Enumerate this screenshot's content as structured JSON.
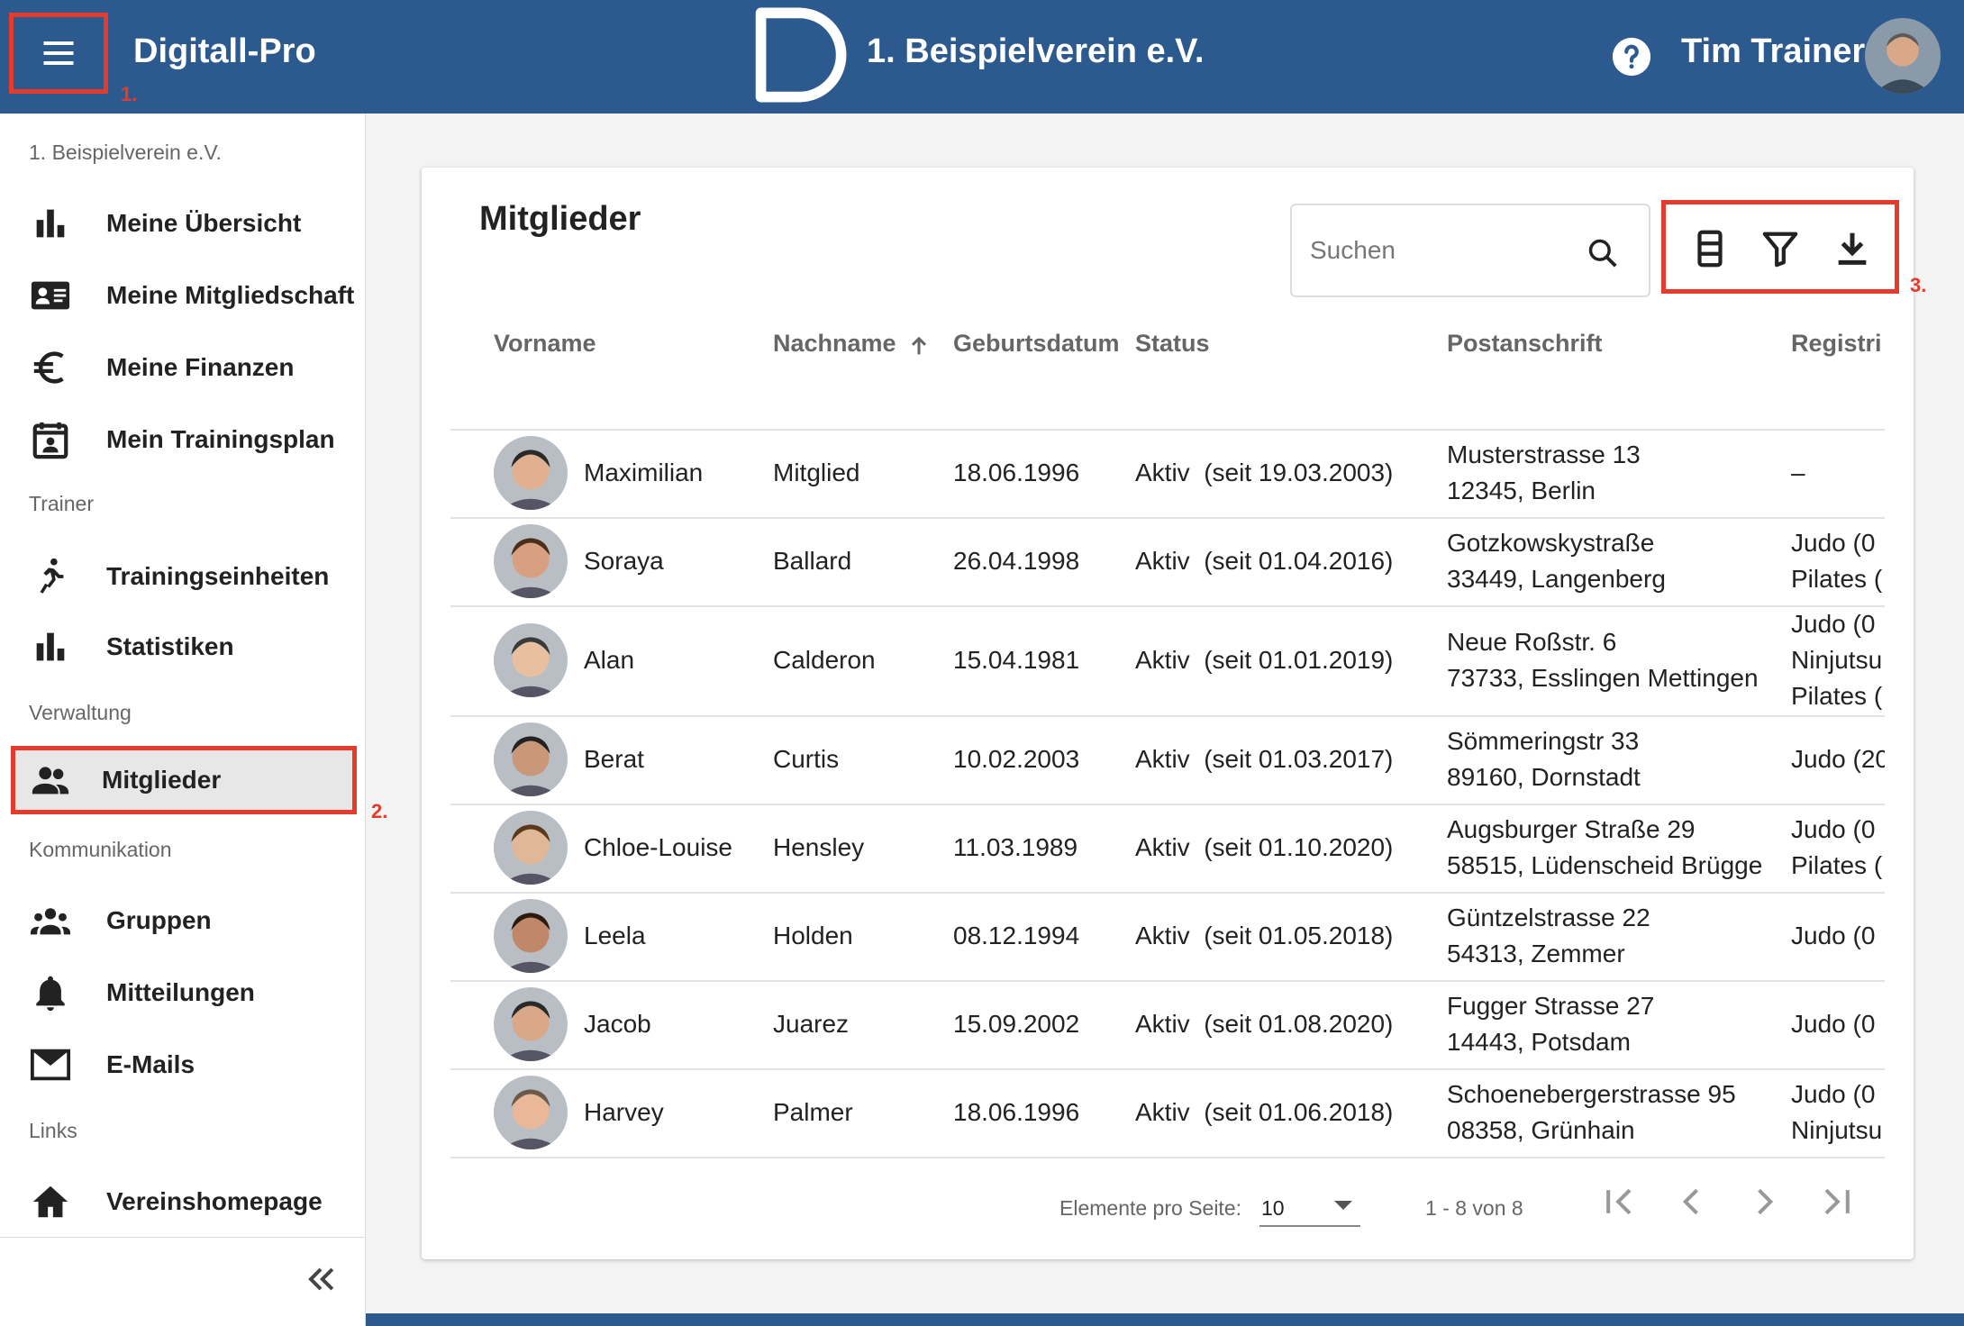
{
  "app": {
    "title": "Digitall-Pro",
    "club_name": "1. Beispielverein e.V.",
    "user_name": "Tim Trainer",
    "brand_color": "#2d5a8e",
    "highlight_color": "#e53b2c"
  },
  "markers": [
    "1.",
    "2.",
    "3."
  ],
  "sidebar": {
    "club_label": "1. Beispielverein e.V.",
    "items": [
      {
        "label": "Meine Übersicht",
        "icon": "bar-chart-icon"
      },
      {
        "label": "Meine Mitgliedschaft",
        "icon": "id-card-icon"
      },
      {
        "label": "Meine Finanzen",
        "icon": "euro-icon"
      },
      {
        "label": "Mein Trainingsplan",
        "icon": "calendar-person-icon"
      },
      {
        "label": "Trainingseinheiten",
        "icon": "running-icon"
      },
      {
        "label": "Statistiken",
        "icon": "bar-chart-icon"
      },
      {
        "label": "Mitglieder",
        "icon": "people-icon",
        "active": true
      },
      {
        "label": "Gruppen",
        "icon": "groups-icon"
      },
      {
        "label": "Mitteilungen",
        "icon": "bell-icon"
      },
      {
        "label": "E-Mails",
        "icon": "mail-icon"
      },
      {
        "label": "Vereinshomepage",
        "icon": "home-icon"
      }
    ],
    "sections": [
      "Trainer",
      "Verwaltung",
      "Kommunikation",
      "Links"
    ]
  },
  "main": {
    "title": "Mitglieder",
    "search": {
      "placeholder": "Suchen",
      "value": ""
    },
    "toolbar": [
      "columns-icon",
      "filter-icon",
      "download-icon"
    ],
    "columns": [
      "Vorname",
      "Nachname",
      "Geburtsdatum",
      "Status",
      "Postanschrift",
      "Registri"
    ],
    "sort": {
      "column": "Nachname",
      "direction": "ascending"
    },
    "rows": [
      {
        "first": "Maximilian",
        "last": "Mitglied",
        "birth": "18.06.1996",
        "status": "Aktiv  (seit 19.03.2003)",
        "street": "Musterstrasse 13",
        "city": "12345, Berlin",
        "reg": [
          "–"
        ]
      },
      {
        "first": "Soraya",
        "last": "Ballard",
        "birth": "26.04.1998",
        "status": "Aktiv  (seit 01.04.2016)",
        "street": "Gotzkowskystraße",
        "city": "33449, Langenberg",
        "reg": [
          "Judo (0",
          "Pilates ("
        ]
      },
      {
        "first": "Alan",
        "last": "Calderon",
        "birth": "15.04.1981",
        "status": "Aktiv  (seit 01.01.2019)",
        "street": "Neue Roßstr. 6",
        "city": "73733, Esslingen Mettingen",
        "reg": [
          "Judo (0",
          "Ninjutsu",
          "Pilates ("
        ]
      },
      {
        "first": "Berat",
        "last": "Curtis",
        "birth": "10.02.2003",
        "status": "Aktiv  (seit 01.03.2017)",
        "street": "Sömmeringstr 33",
        "city": "89160, Dornstadt",
        "reg": [
          "Judo (20"
        ]
      },
      {
        "first": "Chloe-Louise",
        "last": "Hensley",
        "birth": "11.03.1989",
        "status": "Aktiv  (seit 01.10.2020)",
        "street": "Augsburger Straße 29",
        "city": "58515, Lüdenscheid Brügge",
        "reg": [
          "Judo (0",
          "Pilates ("
        ]
      },
      {
        "first": "Leela",
        "last": "Holden",
        "birth": "08.12.1994",
        "status": "Aktiv  (seit 01.05.2018)",
        "street": "Güntzelstrasse 22",
        "city": "54313, Zemmer",
        "reg": [
          "Judo (0"
        ]
      },
      {
        "first": "Jacob",
        "last": "Juarez",
        "birth": "15.09.2002",
        "status": "Aktiv  (seit 01.08.2020)",
        "street": "Fugger Strasse 27",
        "city": "14443, Potsdam",
        "reg": [
          "Judo (0"
        ]
      },
      {
        "first": "Harvey",
        "last": "Palmer",
        "birth": "18.06.1996",
        "status": "Aktiv  (seit 01.06.2018)",
        "street": "Schoenebergerstrasse 95",
        "city": "08358, Grünhain",
        "reg": [
          "Judo (0",
          "Ninjutsu"
        ]
      }
    ],
    "pagination": {
      "label": "Elemente pro Seite:",
      "per_page": "10",
      "range": "1 - 8 von 8"
    }
  }
}
